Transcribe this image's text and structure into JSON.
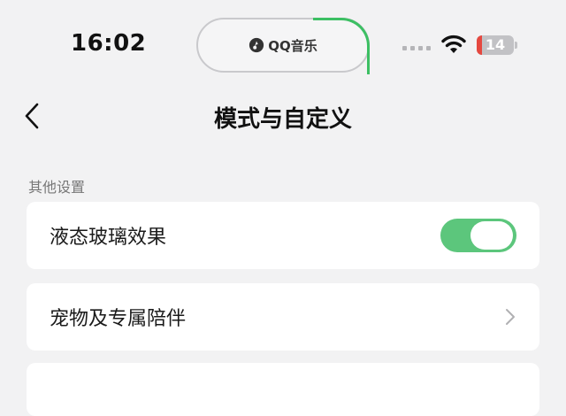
{
  "status_bar": {
    "time": "16:02",
    "island_app": "QQ音乐",
    "battery_level": "14",
    "battery_fraction": 0.14,
    "battery_color": "#e5483f",
    "icons": [
      "signal-dots-icon",
      "wifi-icon",
      "battery-icon"
    ]
  },
  "nav": {
    "back_icon": "chevron-left-icon",
    "title": "模式与自定义"
  },
  "section": {
    "label": "其他设置"
  },
  "rows": [
    {
      "label": "液态玻璃效果",
      "control": "toggle",
      "enabled": true,
      "accent": "#5cc67c"
    },
    {
      "label": "宠物及专属陪伴",
      "control": "chevron-right-icon"
    }
  ]
}
